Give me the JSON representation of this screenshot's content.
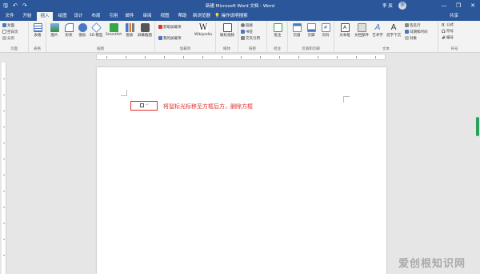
{
  "window": {
    "title": "新建 Microsoft Word 文档 - Word",
    "user_name": "李 辰",
    "avatar_text": "李",
    "qat": [
      {
        "name": "save-icon",
        "glyph": "🖫"
      },
      {
        "name": "undo-icon",
        "glyph": "↶"
      },
      {
        "name": "redo-icon",
        "glyph": "↷"
      }
    ],
    "controls": {
      "minimize": "—",
      "restore": "❐",
      "close": "✕"
    }
  },
  "tabs": [
    {
      "key": "file",
      "label": "文件"
    },
    {
      "key": "home",
      "label": "开始"
    },
    {
      "key": "insert",
      "label": "插入",
      "active": true
    },
    {
      "key": "draw",
      "label": "绘图"
    },
    {
      "key": "design",
      "label": "设计"
    },
    {
      "key": "layout",
      "label": "布局"
    },
    {
      "key": "references",
      "label": "引用"
    },
    {
      "key": "mailings",
      "label": "邮件"
    },
    {
      "key": "review",
      "label": "审阅"
    },
    {
      "key": "view",
      "label": "视图"
    },
    {
      "key": "help",
      "label": "帮助"
    },
    {
      "key": "dev",
      "label": "新浏览器"
    }
  ],
  "tell_me": "操作说明搜索",
  "share": "共享",
  "ribbon": {
    "pages": {
      "name": "页面",
      "items": [
        "封面",
        "空白页",
        "分页"
      ]
    },
    "tables": {
      "name": "表格",
      "table": "表格"
    },
    "illustrations": {
      "name": "插图",
      "picture": "图片",
      "shapes": "形状",
      "icons": "图标",
      "models": "3D 模型",
      "smartart": "SmartArt",
      "chart": "图表",
      "screenshot": "屏幕截图"
    },
    "addins": {
      "name": "加载项",
      "get": "获取加载项",
      "my": "我的加载项",
      "wiki": "Wikipedia"
    },
    "media": {
      "name": "媒体",
      "video": "联机视频"
    },
    "links": {
      "name": "链接",
      "link": "链接",
      "bookmark": "书签",
      "crossref": "交叉引用"
    },
    "comments": {
      "name": "批注",
      "comment": "批注"
    },
    "headerfooter": {
      "name": "页眉和页脚",
      "header": "页眉",
      "footer": "页脚",
      "pagenum": "页码"
    },
    "text": {
      "name": "文本",
      "textbox": "文本框",
      "parts": "文档部件",
      "wordart": "艺术字",
      "dropcap": "首字下沉",
      "sigline": "签名行",
      "datetime": "日期和时间",
      "object": "对象"
    },
    "symbols": {
      "name": "符号",
      "equation": "公式",
      "symbol": "符号",
      "number": "编号"
    }
  },
  "document": {
    "field_mark": "↵",
    "annotation": "将鼠标光标移至方框后方，删除方框"
  },
  "watermark": "爱创根知识网",
  "colors": {
    "accent": "#2b579a",
    "highlight": "#e0312b"
  }
}
